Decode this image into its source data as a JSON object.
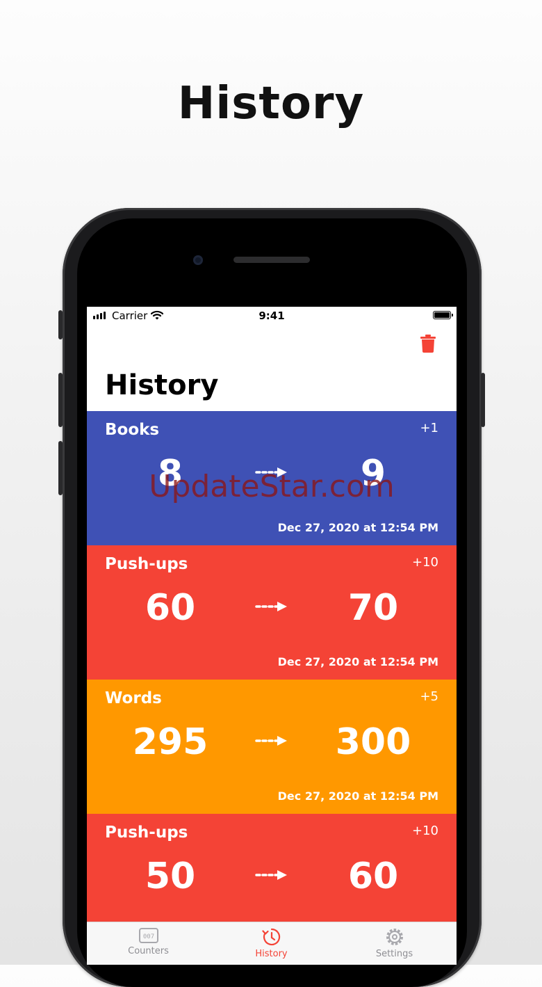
{
  "banner": {
    "title": "History"
  },
  "status_bar": {
    "carrier": "Carrier",
    "time": "9:41"
  },
  "header": {
    "title": "History"
  },
  "icons": {
    "trash": "trash-icon",
    "arrow": "dashed-arrow-icon"
  },
  "colors": {
    "books": "#3f51b5",
    "push_ups": "#f44336",
    "words": "#ff9800",
    "accent": "#f44336"
  },
  "history": [
    {
      "name": "Books",
      "delta": "+1",
      "from": "8",
      "to": "9",
      "date": "Dec 27, 2020 at 12:54 PM",
      "color": "#3f51b5"
    },
    {
      "name": "Push-ups",
      "delta": "+10",
      "from": "60",
      "to": "70",
      "date": "Dec 27, 2020 at 12:54 PM",
      "color": "#f44336"
    },
    {
      "name": "Words",
      "delta": "+5",
      "from": "295",
      "to": "300",
      "date": "Dec 27, 2020 at 12:54 PM",
      "color": "#ff9800"
    },
    {
      "name": "Push-ups",
      "delta": "+10",
      "from": "50",
      "to": "60",
      "date": "",
      "color": "#f44336"
    }
  ],
  "watermark": "UpdateStar.com",
  "tabs": [
    {
      "label": "Counters",
      "icon": "counter-icon",
      "active": false
    },
    {
      "label": "History",
      "icon": "clock-icon",
      "active": true
    },
    {
      "label": "Settings",
      "icon": "gear-icon",
      "active": false
    }
  ]
}
